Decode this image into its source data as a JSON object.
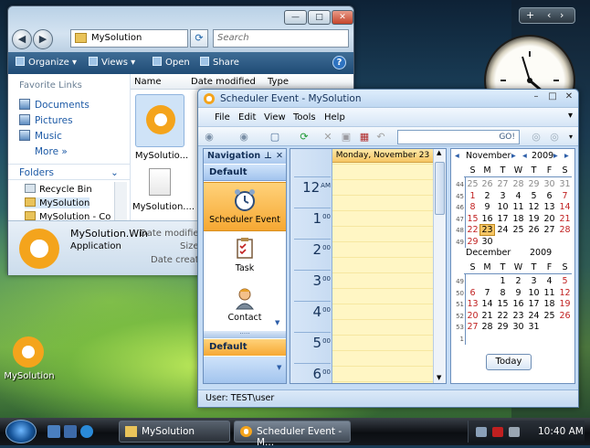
{
  "explorer": {
    "address": "MySolution",
    "search_placeholder": "Search",
    "toolbar": {
      "organize": "Organize",
      "views": "Views",
      "open": "Open",
      "share": "Share"
    },
    "caption_buttons": {
      "minimize": "—",
      "maximize": "□",
      "close": "✕"
    },
    "favorite_links_title": "Favorite Links",
    "favorites": [
      "Documents",
      "Pictures",
      "Music"
    ],
    "more": "More",
    "folders_title": "Folders",
    "tree": [
      "Recycle Bin",
      "MySolution",
      "MySolution - Co"
    ],
    "columns": [
      "Name",
      "Date modified",
      "Type"
    ],
    "files": [
      "MySolutio...",
      "MySolution...."
    ],
    "details": {
      "name": "MySolution.Win",
      "type": "Application",
      "labels": [
        "Date modified:",
        "Size:",
        "Date created:"
      ]
    }
  },
  "scheduler": {
    "title": "Scheduler Event - MySolution",
    "menu": [
      "File",
      "Edit",
      "View",
      "Tools",
      "Help"
    ],
    "go_label": "GO!",
    "nav": {
      "title": "Navigation",
      "group1": "Default",
      "items": [
        {
          "label": "Scheduler Event",
          "icon": "alarm-clock-icon"
        },
        {
          "label": "Task",
          "icon": "task-checklist-icon"
        },
        {
          "label": "Contact",
          "icon": "contact-person-icon"
        }
      ],
      "group2": "Default"
    },
    "dayview": {
      "header": "Monday, November 23",
      "hours": [
        {
          "h": "12",
          "ampm": "AM"
        },
        {
          "h": "1",
          "ampm": "00"
        },
        {
          "h": "2",
          "ampm": "00"
        },
        {
          "h": "3",
          "ampm": "00"
        },
        {
          "h": "4",
          "ampm": "00"
        },
        {
          "h": "5",
          "ampm": "00"
        },
        {
          "h": "6",
          "ampm": "00"
        }
      ]
    },
    "calendar": {
      "weekdays": [
        "S",
        "M",
        "T",
        "W",
        "T",
        "F",
        "S"
      ],
      "months": [
        {
          "name": "November",
          "year": "2009",
          "weeks": [
            {
              "wk": "44",
              "days": [
                "25",
                "26",
                "27",
                "28",
                "29",
                "30",
                "31"
              ]
            },
            {
              "wk": "45",
              "days": [
                "1",
                "2",
                "3",
                "4",
                "5",
                "6",
                "7"
              ]
            },
            {
              "wk": "46",
              "days": [
                "8",
                "9",
                "10",
                "11",
                "12",
                "13",
                "14"
              ]
            },
            {
              "wk": "47",
              "days": [
                "15",
                "16",
                "17",
                "18",
                "19",
                "20",
                "21"
              ]
            },
            {
              "wk": "48",
              "days": [
                "22",
                "23",
                "24",
                "25",
                "26",
                "27",
                "28"
              ]
            },
            {
              "wk": "49",
              "days": [
                "29",
                "30",
                "",
                "",
                "",
                "",
                ""
              ]
            }
          ]
        },
        {
          "name": "December",
          "year": "2009",
          "weeks": [
            {
              "wk": "49",
              "days": [
                "",
                "",
                "1",
                "2",
                "3",
                "4",
                "5"
              ]
            },
            {
              "wk": "50",
              "days": [
                "6",
                "7",
                "8",
                "9",
                "10",
                "11",
                "12"
              ]
            },
            {
              "wk": "51",
              "days": [
                "13",
                "14",
                "15",
                "16",
                "17",
                "18",
                "19"
              ]
            },
            {
              "wk": "52",
              "days": [
                "20",
                "21",
                "22",
                "23",
                "24",
                "25",
                "26"
              ]
            },
            {
              "wk": "53",
              "days": [
                "27",
                "28",
                "29",
                "30",
                "31",
                "",
                ""
              ]
            },
            {
              "wk": "1",
              "days": [
                "",
                "",
                "",
                "",
                "",
                "",
                ""
              ]
            }
          ]
        }
      ],
      "today_button": "Today",
      "selected_day": "23"
    },
    "status": "User: TEST\\user"
  },
  "desktop": {
    "icon_label": "MySolution"
  },
  "taskbar": {
    "tasks": [
      "MySolution",
      "Scheduler Event - M..."
    ],
    "time": "10:40 AM"
  },
  "colors": {
    "accent_orange": "#f6a833",
    "weekend_red": "#c02020",
    "selected_day": "#f6c665"
  }
}
